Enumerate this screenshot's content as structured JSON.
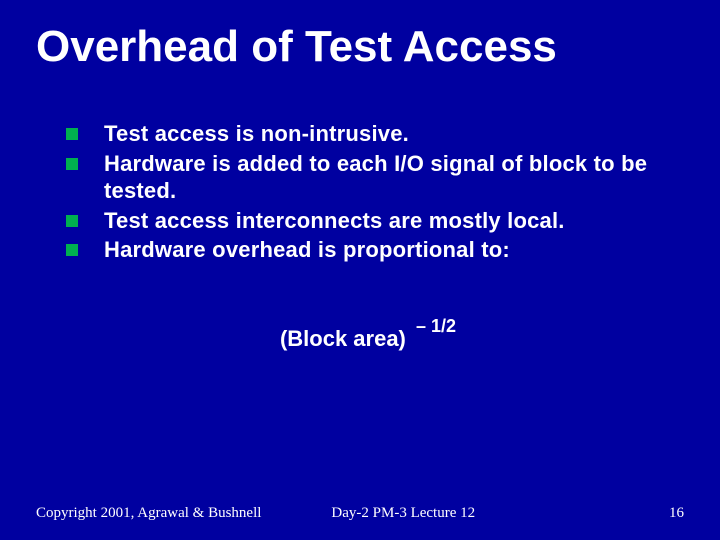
{
  "title": "Overhead of Test Access",
  "bullets": [
    "Test access is non-intrusive.",
    "Hardware is added to each I/O signal of block to be tested.",
    "Test access interconnects are mostly local.",
    "Hardware overhead is proportional to:"
  ],
  "formula": {
    "base": "(Block area)",
    "exponent": "– 1/2"
  },
  "footer": {
    "left": "Copyright 2001, Agrawal & Bushnell",
    "center": "Day-2 PM-3 Lecture 12",
    "page": "16"
  }
}
